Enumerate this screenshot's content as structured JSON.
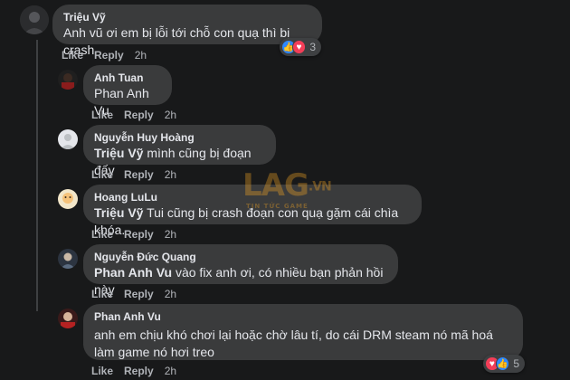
{
  "comments": [
    {
      "author": "Triệu Vỹ",
      "text": "Anh vũ ơi em bị lỗi tới chỗ con quạ thì bị crash",
      "like": "Like",
      "reply": "Reply",
      "time": "2h",
      "reaction_count": "3"
    },
    {
      "author": "Anh Tuan",
      "text": "Phan Anh Vu",
      "like": "Like",
      "reply": "Reply",
      "time": "2h"
    },
    {
      "author": "Nguyễn Huy Hoàng",
      "mention": "Triệu Vỹ",
      "text": " mình cũng bị đoạn đấy",
      "like": "Like",
      "reply": "Reply",
      "time": "2h"
    },
    {
      "author": "Hoang LuLu",
      "mention": "Triệu Vỹ",
      "text": " Tui cũng bị crash đoạn con quạ gặm cái chìa khóa.",
      "like": "Like",
      "reply": "Reply",
      "time": "2h"
    },
    {
      "author": "Nguyễn Đức Quang",
      "mention": "Phan Anh Vu",
      "text": " vào fix anh ơi, có nhiều bạn phản hồi này",
      "like": "Like",
      "reply": "Reply",
      "time": "2h"
    },
    {
      "author": "Phan Anh Vu",
      "text": "anh em chịu khó chơi lại hoặc chờ lâu tí, do cái DRM steam nó mã hoá làm game nó hơi treo",
      "like": "Like",
      "reply": "Reply",
      "time": "2h",
      "reaction_count": "5"
    }
  ],
  "watermark": {
    "logo_text": "LAG",
    "suffix": ".VN",
    "tagline": "TIN TỨC GAME"
  },
  "colors": {
    "background": "#18191a",
    "bubble": "#3a3b3c",
    "like": "#2d88ff",
    "love": "#f33e58",
    "watermark": "#f5a623"
  }
}
